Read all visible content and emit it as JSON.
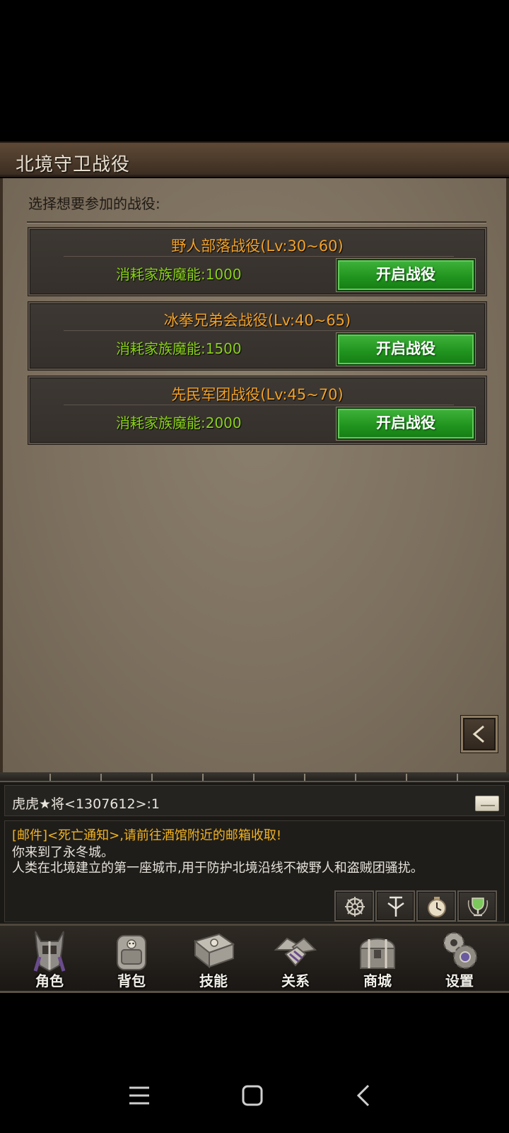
{
  "window": {
    "title": "北境守卫战役"
  },
  "prompt": "选择想要参加的战役:",
  "campaigns": [
    {
      "name": "野人部落战役(Lv:30~60)",
      "cost": "消耗家族魔能:1000",
      "button": "开启战役"
    },
    {
      "name": "冰拳兄弟会战役(Lv:40~65)",
      "cost": "消耗家族魔能:1500",
      "button": "开启战役"
    },
    {
      "name": "先民军团战役(Lv:45~70)",
      "cost": "消耗家族魔能:2000",
      "button": "开启战役"
    }
  ],
  "chat": {
    "input_line": "虎虎★将<1307612>:1",
    "mail_notice": "[邮件]<死亡通知>,请前往酒馆附近的邮箱收取!",
    "messages": [
      "你来到了永冬城。",
      "人类在北境建立的第一座城市,用于防护北境沿线不被野人和盗贼团骚扰。"
    ],
    "tools": [
      "gear-wheel-icon",
      "rune-icon",
      "clock-icon",
      "trophy-icon"
    ]
  },
  "nav": [
    {
      "label": "角色",
      "icon": "helmet-icon"
    },
    {
      "label": "背包",
      "icon": "backpack-icon"
    },
    {
      "label": "技能",
      "icon": "skill-book-icon"
    },
    {
      "label": "关系",
      "icon": "handshake-icon"
    },
    {
      "label": "商城",
      "icon": "treasure-chest-icon"
    },
    {
      "label": "设置",
      "icon": "gears-icon"
    }
  ],
  "colors": {
    "campaign_name": "#f2a22a",
    "cost": "#8ad11b",
    "button_green": "#21951f",
    "mail": "#f1b323",
    "parchment": "#7d705f"
  }
}
